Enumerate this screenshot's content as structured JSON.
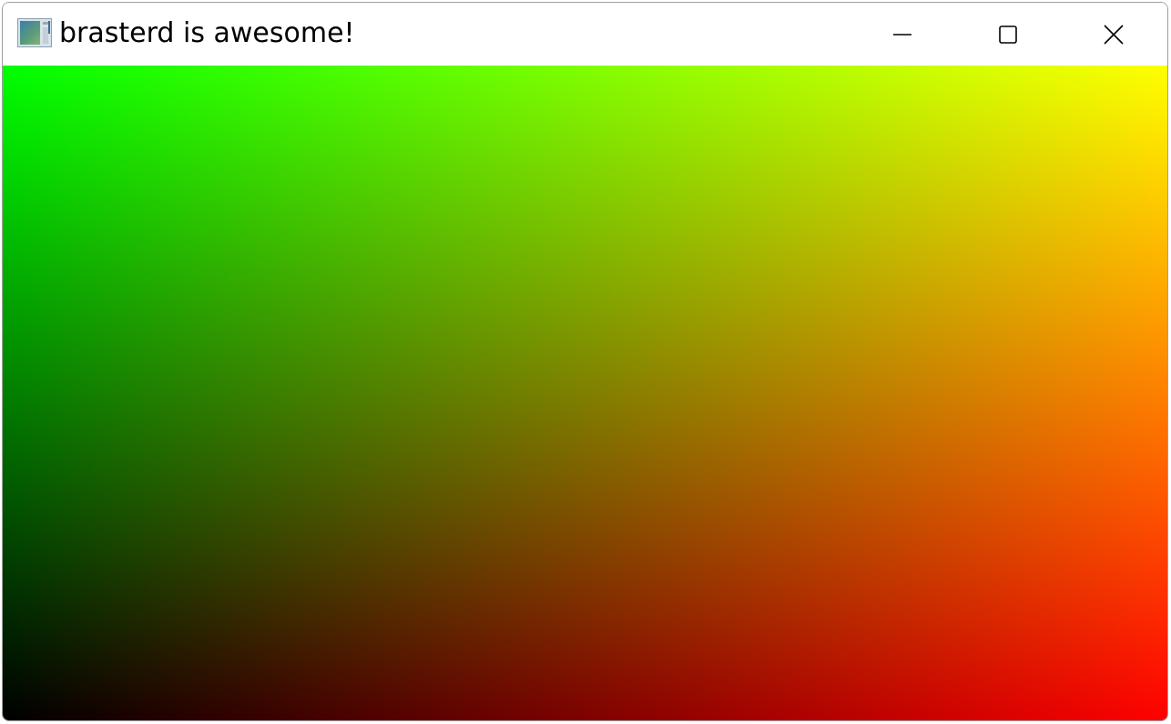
{
  "window": {
    "title": "brasterd is awesome!",
    "icon": "app-window-icon",
    "controls": {
      "minimize_icon": "minimize-icon",
      "maximize_icon": "maximize-icon",
      "close_icon": "close-icon"
    }
  },
  "canvas": {
    "description_colors": {
      "top_left": "#00ff00",
      "top_right": "#ffff00",
      "bottom_left": "#000000",
      "bottom_right": "#ff0000"
    }
  }
}
